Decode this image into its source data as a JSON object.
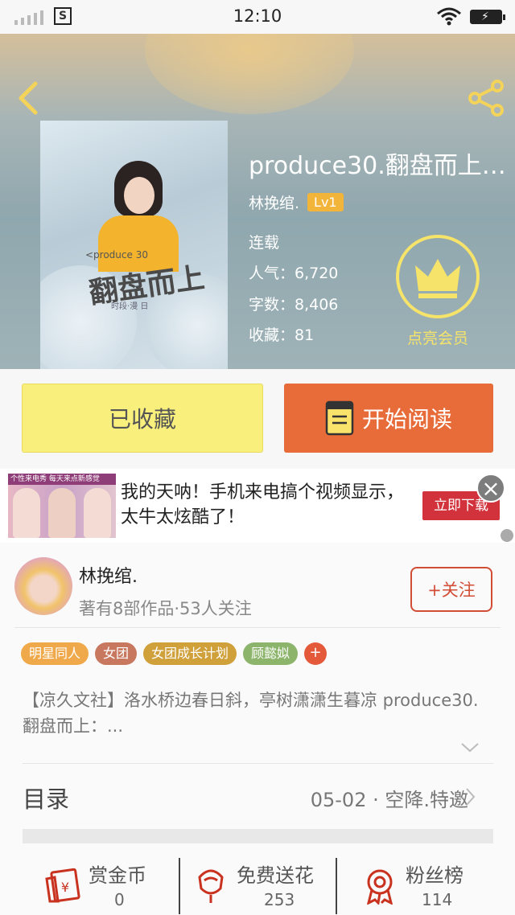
{
  "status_bar": {
    "time": "12:10",
    "sim_label": "S"
  },
  "book": {
    "title": "produce30.翻盘而上：...",
    "author": "林挽绾.",
    "level": "Lv1",
    "status": "连载",
    "popularity": "人气：6,720",
    "word_count": "字数：8,406",
    "favorites": "收藏：81",
    "cover_small_text": "<produce 30",
    "cover_title": "翻盘而上",
    "cover_subline": "时段·漫 日"
  },
  "vip": {
    "label": "点亮会员"
  },
  "actions": {
    "favorited_label": "已收藏",
    "read_label": "开始阅读"
  },
  "ad": {
    "image_caption": "个性来电秀   每天来点新感觉",
    "text": "我的天呐！手机来电搞个视频显示，太牛太炫酷了！",
    "button": "立即下载",
    "close": "×"
  },
  "author": {
    "name": "林挽绾.",
    "stats": "著有8部作品·53人关注",
    "follow_label": "+关注"
  },
  "tags": [
    {
      "label": "明星同人",
      "color": "#f0a94a"
    },
    {
      "label": "女团",
      "color": "#c7785f"
    },
    {
      "label": "女团成长计划",
      "color": "#d0a03b"
    },
    {
      "label": "顾懿姒",
      "color": "#8cb46a"
    }
  ],
  "tag_more": "+",
  "intro": "【凉久文社】洛水桥边春日斜，亭树潇潇生暮凉 produce30.翻盘而上：...",
  "toc": {
    "label": "目录",
    "latest": "05-02 · 空降.特邀"
  },
  "bottom": {
    "reward": {
      "label": "赏金币",
      "count": "0"
    },
    "flowers": {
      "label": "免费送花",
      "count": "253"
    },
    "fans": {
      "label": "粉丝榜",
      "count": "114"
    }
  },
  "colors": {
    "accent": "#e86c3a",
    "favorite_bg": "#f9ef7c",
    "vip": "#f6e46a",
    "follow": "#d24d36"
  }
}
